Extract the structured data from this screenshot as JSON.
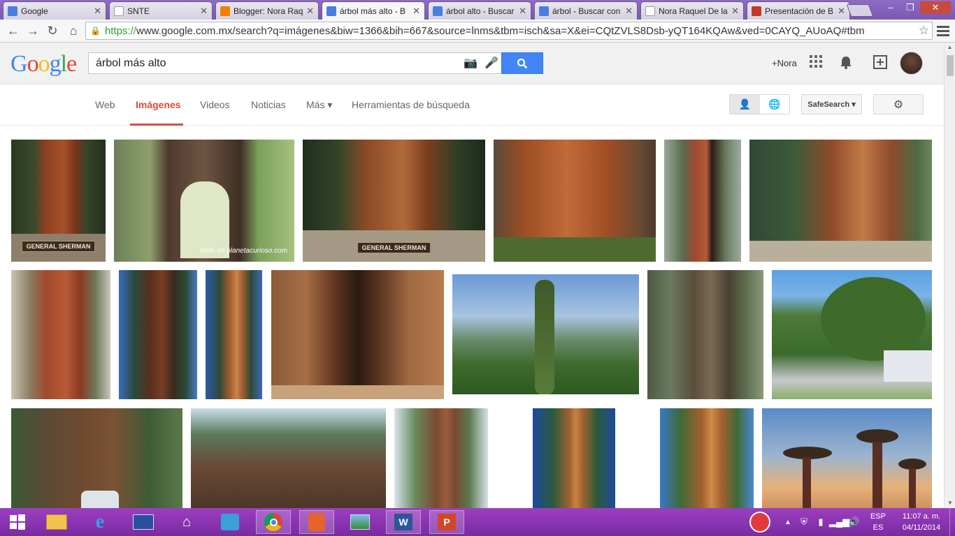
{
  "browser": {
    "tabs": [
      {
        "title": "Google",
        "favicon": "google-g",
        "color": "#4a7ee0",
        "active": false
      },
      {
        "title": "SNTE",
        "favicon": "page",
        "color": "#ffffff",
        "active": false
      },
      {
        "title": "Blogger: Nora Raq",
        "favicon": "blogger",
        "color": "#f57d00",
        "active": false
      },
      {
        "title": "árbol más alto - B",
        "favicon": "google-g",
        "color": "#4a7ee0",
        "active": true
      },
      {
        "title": "árbol alto - Buscar",
        "favicon": "google-g",
        "color": "#4a7ee0",
        "active": false
      },
      {
        "title": "árbol - Buscar con",
        "favicon": "google-g",
        "color": "#4a7ee0",
        "active": false
      },
      {
        "title": "Nora Raquel De la",
        "favicon": "page",
        "color": "#ffffff",
        "active": false
      },
      {
        "title": "Presentación de B",
        "favicon": "bitly",
        "color": "#c0392b",
        "active": false
      }
    ],
    "url_secure": "https://",
    "url_rest": "www.google.com.mx/search?q=imágenes&biw=1366&bih=667&source=lnms&tbm=isch&sa=X&ei=CQtZVLS8Dsb-yQT164KQAw&ved=0CAYQ_AUoAQ#tbm"
  },
  "google": {
    "logo": "Google",
    "query": "árbol más alto",
    "user_label": "+Nora",
    "nav_tabs": [
      {
        "label": "Web",
        "active": false
      },
      {
        "label": "Imágenes",
        "active": true
      },
      {
        "label": "Videos",
        "active": false
      },
      {
        "label": "Noticias",
        "active": false
      },
      {
        "label": "Más ▾",
        "active": false
      },
      {
        "label": "Herramientas de búsqueda",
        "active": false
      }
    ],
    "safesearch": "SafeSearch ▾"
  },
  "image_labels": {
    "sherman1": "GENERAL SHERMAN",
    "sherman2": "GENERAL SHERMAN",
    "caption": "Visto en planetacurioso.com"
  },
  "taskbar": {
    "lang_top": "ESP",
    "lang_bottom": "ES",
    "time": "11:07 a. m.",
    "date": "04/11/2014"
  }
}
